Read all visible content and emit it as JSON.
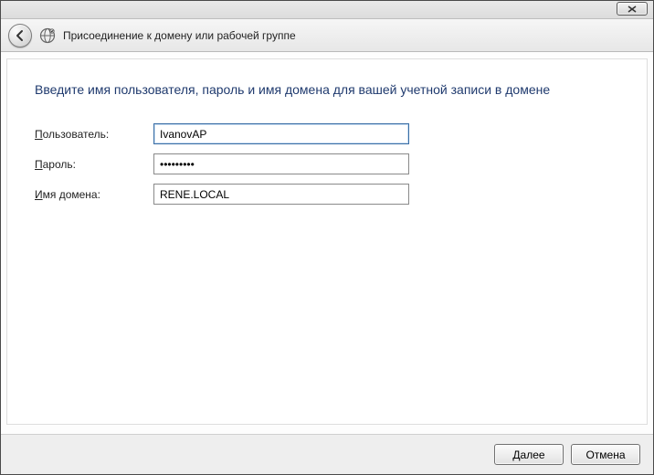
{
  "titlebar": {
    "close_label": "Close"
  },
  "header": {
    "title": "Присоединение к домену или рабочей группе"
  },
  "main": {
    "instruction": "Введите имя пользователя, пароль и имя домена для вашей учетной записи в домене",
    "fields": {
      "username": {
        "label_pre": "П",
        "label_rest": "ользователь:",
        "value": "IvanovAP"
      },
      "password": {
        "label_pre": "П",
        "label_rest": "ароль:",
        "value": "•••••••••"
      },
      "domain": {
        "label_pre": "И",
        "label_rest": "мя домена:",
        "value": "RENE.LOCAL"
      }
    }
  },
  "footer": {
    "next_pre": "Д",
    "next_rest": "алее",
    "cancel": "Отмена"
  }
}
